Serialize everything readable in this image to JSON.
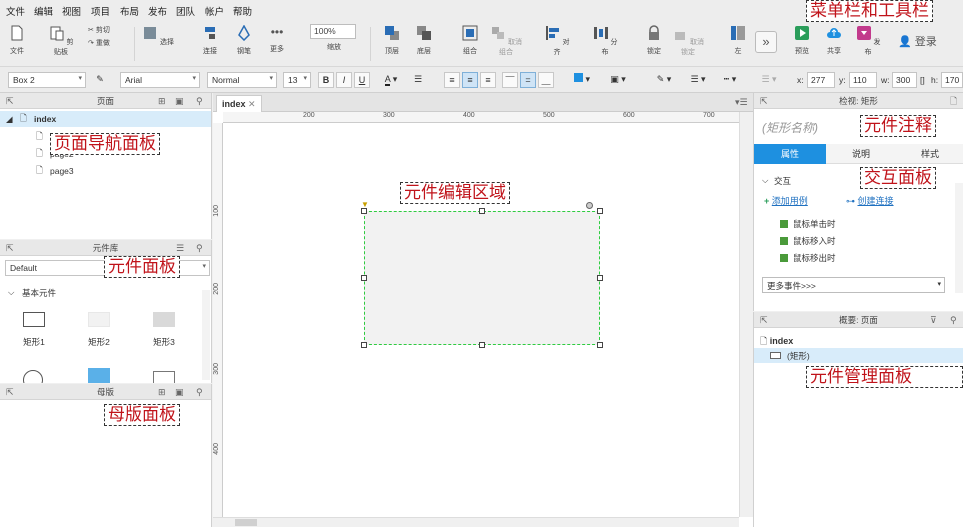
{
  "menu": [
    "文件",
    "编辑",
    "视图",
    "项目",
    "布局",
    "发布",
    "团队",
    "帐户",
    "帮助"
  ],
  "toolbar": {
    "file": "文件",
    "clipboard": "剪贴板",
    "cut": "剪切",
    "redo": "重做",
    "select": "选择",
    "connect": "连接",
    "pen": "钢笔",
    "more": "更多",
    "zoom_value": "100%",
    "zoom": "缩放",
    "top": "顶层",
    "bottom": "底层",
    "group": "组合",
    "ungroup": "取消组合",
    "align": "对齐",
    "distribute": "分布",
    "lock": "锁定",
    "unlock": "取消锁定",
    "left": "左",
    "preview": "预览",
    "share": "共享",
    "publish": "发布",
    "login": "登录"
  },
  "format": {
    "widget_select": "Box 2",
    "font": "Arial",
    "style": "Normal",
    "size": "13",
    "x_label": "x:",
    "x": "277",
    "y_label": "y:",
    "y": "110",
    "w_label": "w:",
    "w": "300",
    "h_label": "h:",
    "h": "170"
  },
  "pages_panel": {
    "title": "页面",
    "root": "index",
    "pages": [
      "page1",
      "page2",
      "page3"
    ]
  },
  "library_panel": {
    "title": "元件库",
    "library": "Default",
    "section": "基本元件",
    "items": [
      "矩形1",
      "矩形2",
      "矩形3"
    ]
  },
  "masters_panel": {
    "title": "母版"
  },
  "canvas": {
    "tab": "index",
    "ruler_h": [
      "200",
      "300",
      "400",
      "500",
      "600",
      "700"
    ],
    "ruler_v": [
      "100",
      "200",
      "300",
      "400"
    ]
  },
  "inspector": {
    "title": "检视: 矩形",
    "name_placeholder": "(矩形名称)",
    "tabs": [
      "属性",
      "说明",
      "样式"
    ],
    "section": "交互",
    "add_case": "添加用例",
    "create_link": "创建连接",
    "events": [
      "鼠标单击时",
      "鼠标移入时",
      "鼠标移出时"
    ],
    "more_events": "更多事件>>>"
  },
  "outline": {
    "title": "概要: 页面",
    "root": "index",
    "item": "(矩形)"
  },
  "annotations": {
    "menubar": "菜单栏和工具栏",
    "pages": "页面导航面板",
    "library": "元件面板",
    "masters": "母版面板",
    "canvas": "元件编辑区域",
    "notes": "元件注释",
    "interaction": "交互面板",
    "outline": "元件管理面板"
  },
  "colors": {
    "accent": "#1e90e0",
    "annotation": "#c0131a",
    "selection": "#2ecc40"
  }
}
